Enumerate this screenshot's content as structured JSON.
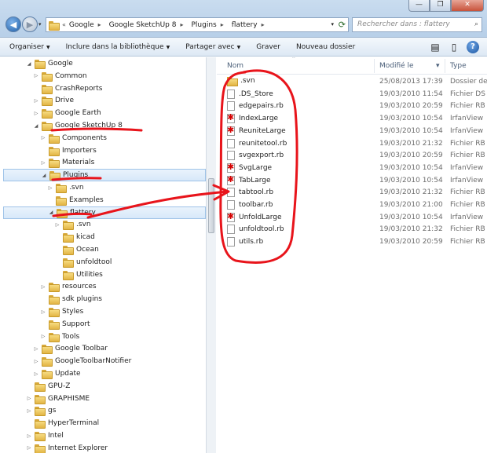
{
  "window": {
    "controls": [
      "—",
      "❐",
      "✕"
    ]
  },
  "address": {
    "prefix": "«",
    "segments": [
      "Google",
      "Google SketchUp 8",
      "Plugins",
      "flattery"
    ]
  },
  "search": {
    "placeholder": "Rechercher dans : flattery"
  },
  "toolbar": {
    "items": [
      "Organiser",
      "Inclure dans la bibliothèque",
      "Partager avec",
      "Graver",
      "Nouveau dossier"
    ]
  },
  "nav_tree": [
    {
      "label": "Google",
      "indent": 0,
      "expanded": true
    },
    {
      "label": "Common",
      "indent": 1,
      "expanded": false
    },
    {
      "label": "CrashReports",
      "indent": 1,
      "expanded": null
    },
    {
      "label": "Drive",
      "indent": 1,
      "expanded": false
    },
    {
      "label": "Google Earth",
      "indent": 1,
      "expanded": false
    },
    {
      "label": "Google SketchUp 8",
      "indent": 1,
      "expanded": true
    },
    {
      "label": "Components",
      "indent": 2,
      "expanded": false
    },
    {
      "label": "Importers",
      "indent": 2,
      "expanded": null
    },
    {
      "label": "Materials",
      "indent": 2,
      "expanded": false
    },
    {
      "label": "Plugins",
      "indent": 2,
      "expanded": true,
      "selected": true
    },
    {
      "label": ".svn",
      "indent": 3,
      "expanded": false
    },
    {
      "label": "Examples",
      "indent": 3,
      "expanded": null
    },
    {
      "label": "flattery",
      "indent": 3,
      "expanded": true,
      "selected": true
    },
    {
      "label": ".svn",
      "indent": 4,
      "expanded": false
    },
    {
      "label": "kicad",
      "indent": 4,
      "expanded": null
    },
    {
      "label": "Ocean",
      "indent": 4,
      "expanded": null
    },
    {
      "label": "unfoldtool",
      "indent": 4,
      "expanded": null
    },
    {
      "label": "Utilities",
      "indent": 4,
      "expanded": null
    },
    {
      "label": "resources",
      "indent": 2,
      "expanded": false
    },
    {
      "label": "sdk plugins",
      "indent": 2,
      "expanded": null
    },
    {
      "label": "Styles",
      "indent": 2,
      "expanded": false
    },
    {
      "label": "Support",
      "indent": 2,
      "expanded": null
    },
    {
      "label": "Tools",
      "indent": 2,
      "expanded": false
    },
    {
      "label": "Google Toolbar",
      "indent": 1,
      "expanded": false
    },
    {
      "label": "GoogleToolbarNotifier",
      "indent": 1,
      "expanded": false
    },
    {
      "label": "Update",
      "indent": 1,
      "expanded": false
    },
    {
      "label": "GPU-Z",
      "indent": 0,
      "expanded": null
    },
    {
      "label": "GRAPHISME",
      "indent": 0,
      "expanded": false
    },
    {
      "label": "gs",
      "indent": 0,
      "expanded": false
    },
    {
      "label": "HyperTerminal",
      "indent": 0,
      "expanded": null
    },
    {
      "label": "Intel",
      "indent": 0,
      "expanded": false
    },
    {
      "label": "Internet Explorer",
      "indent": 0,
      "expanded": false
    }
  ],
  "columns": {
    "name": "Nom",
    "modified": "Modifié le",
    "type": "Type"
  },
  "files": [
    {
      "name": ".svn",
      "date": "25/08/2013 17:39",
      "type": "Dossier de",
      "icon": "dir"
    },
    {
      "name": ".DS_Store",
      "date": "19/03/2010 11:54",
      "type": "Fichier DS",
      "icon": "file"
    },
    {
      "name": "edgepairs.rb",
      "date": "19/03/2010 20:59",
      "type": "Fichier RB",
      "icon": "file"
    },
    {
      "name": "IndexLarge",
      "date": "19/03/2010 10:54",
      "type": "IrfanView",
      "icon": "irfan"
    },
    {
      "name": "ReuniteLarge",
      "date": "19/03/2010 10:54",
      "type": "IrfanView",
      "icon": "irfan"
    },
    {
      "name": "reunitetool.rb",
      "date": "19/03/2010 21:32",
      "type": "Fichier RB",
      "icon": "file"
    },
    {
      "name": "svgexport.rb",
      "date": "19/03/2010 20:59",
      "type": "Fichier RB",
      "icon": "file"
    },
    {
      "name": "SvgLarge",
      "date": "19/03/2010 10:54",
      "type": "IrfanView",
      "icon": "irfan"
    },
    {
      "name": "TabLarge",
      "date": "19/03/2010 10:54",
      "type": "IrfanView",
      "icon": "irfan"
    },
    {
      "name": "tabtool.rb",
      "date": "19/03/2010 21:32",
      "type": "Fichier RB",
      "icon": "file"
    },
    {
      "name": "toolbar.rb",
      "date": "19/03/2010 21:00",
      "type": "Fichier RB",
      "icon": "file"
    },
    {
      "name": "UnfoldLarge",
      "date": "19/03/2010 10:54",
      "type": "IrfanView",
      "icon": "irfan"
    },
    {
      "name": "unfoldtool.rb",
      "date": "19/03/2010 21:32",
      "type": "Fichier RB",
      "icon": "file"
    },
    {
      "name": "utils.rb",
      "date": "19/03/2010 20:59",
      "type": "Fichier RB",
      "icon": "file"
    }
  ],
  "icons": {
    "back": "back-arrow-icon",
    "forward": "forward-arrow-icon",
    "refresh": "refresh-icon",
    "search": "search-icon",
    "views": "views-icon",
    "preview": "preview-pane-icon",
    "help": "help-icon"
  },
  "colors": {
    "annotation": "#e8141b",
    "selection": "#d7e8f9",
    "folder": "#e2b544",
    "irfan_star": "#d40000"
  }
}
